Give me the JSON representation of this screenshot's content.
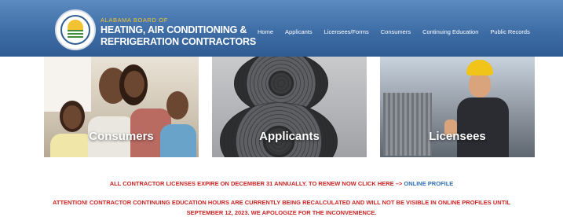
{
  "header": {
    "logo": {
      "icon": "state-seal-icon"
    },
    "brand_small": "ALABAMA BOARD OF",
    "brand_line1": "HEATING, AIR CONDITIONING &",
    "brand_line2": "REFRIGERATION CONTRACTORS",
    "nav": [
      "Home",
      "Applicants",
      "Licensees/Forms",
      "Consumers",
      "Continuing Education",
      "Public Records"
    ]
  },
  "panels": [
    {
      "label": "Consumers"
    },
    {
      "label": "Applicants"
    },
    {
      "label": "Licensees"
    }
  ],
  "notices": {
    "renewal_text": "ALL CONTRACTOR LICENSES EXPIRE ON DECEMBER 31 ANNUALLY. TO RENEW NOW CLICK HERE –> ",
    "renewal_link": "ONLINE PROFILE",
    "attention_line1": "ATTENTION! CONTRACTOR CONTINUING EDUCATION HOURS ARE CURRENTLY BEING RECALCULATED AND WILL NOT BE VISIBLE IN ONLINE PROFILES UNTIL",
    "attention_line2": "SEPTEMBER 12, 2023. WE APOLOGIZE FOR THE INCONVENIENCE."
  },
  "colors": {
    "header_blue": "#3f6da6",
    "brand_gold": "#f2c531",
    "notice_red": "#cc2222",
    "link_blue": "#2f6fb3"
  }
}
